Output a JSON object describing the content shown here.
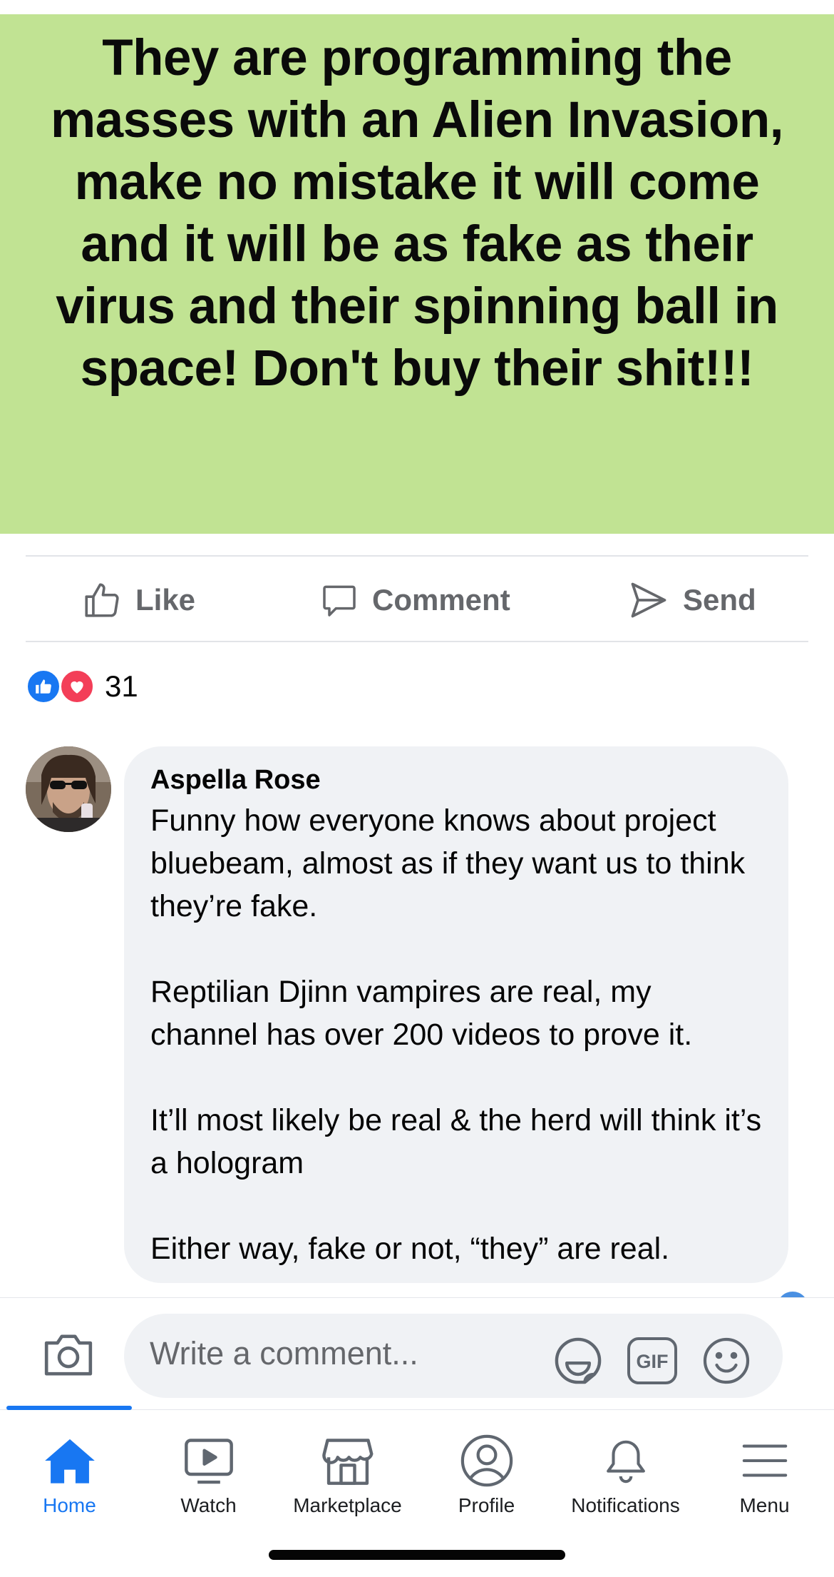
{
  "post": {
    "text": "They are programming the masses with an Alien Invasion, make no mistake it will come and it will be as fake as their virus and their spinning ball in space! Don't buy their shit!!!",
    "background": "#c1e393"
  },
  "actions": {
    "like_label": "Like",
    "comment_label": "Comment",
    "send_label": "Send"
  },
  "reactions": {
    "count": "31",
    "icons": [
      "like-icon",
      "love-icon"
    ]
  },
  "comment": {
    "author": "Aspella Rose",
    "paragraphs": [
      "Funny how everyone knows about project bluebeam, almost as if they want us to think they’re fake.",
      "Reptilian Djinn vampires are real, my channel has over 200 videos to prove it.",
      "It’ll most likely be real & the herd will think it’s a hologram",
      "Either way, fake or not, “they” are real."
    ]
  },
  "composer": {
    "placeholder": "Write a comment...",
    "gif_label": "GIF"
  },
  "nav": {
    "items": [
      {
        "label": "Home",
        "icon": "home-icon",
        "active": true
      },
      {
        "label": "Watch",
        "icon": "watch-icon",
        "active": false
      },
      {
        "label": "Marketplace",
        "icon": "marketplace-icon",
        "active": false
      },
      {
        "label": "Profile",
        "icon": "profile-icon",
        "active": false
      },
      {
        "label": "Notifications",
        "icon": "bell-icon",
        "active": false
      },
      {
        "label": "Menu",
        "icon": "menu-icon",
        "active": false
      }
    ]
  },
  "colors": {
    "accent": "#1877f2",
    "secondary_text": "#65676b",
    "bubble": "#f0f2f5",
    "love": "#f33e58"
  }
}
